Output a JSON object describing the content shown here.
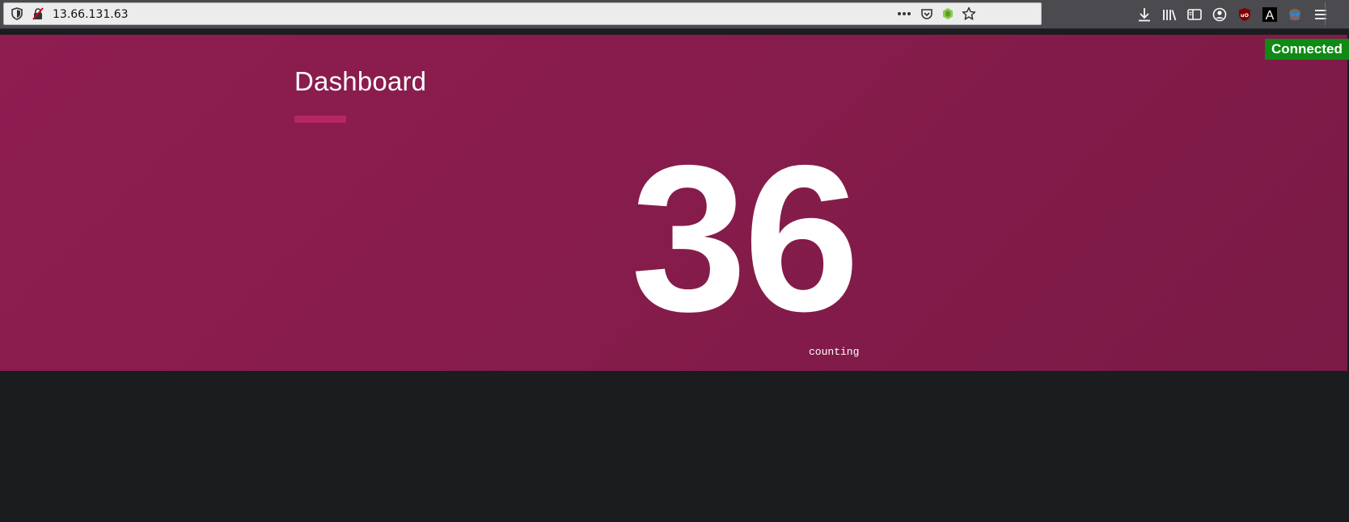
{
  "browser": {
    "url": "13.66.131.63",
    "icons": {
      "tracking_protection": "shield-icon",
      "insecure": "insecure-lock-icon",
      "page_actions": "more-dots-icon",
      "pocket": "pocket-icon",
      "extension": "node-extension-icon",
      "bookmark": "star-icon",
      "downloads": "download-icon",
      "library": "library-icon",
      "sidebar": "sidebar-icon",
      "account": "account-icon",
      "ublock": "ublock-icon",
      "font_ext": "font-a-icon",
      "mask_ext": "mask-icon",
      "menu": "hamburger-menu-icon"
    },
    "ublock_label": "uO",
    "font_ext_label": "A"
  },
  "dashboard": {
    "title": "Dashboard",
    "counter_value": "36",
    "counter_label": "counting",
    "status": "Connected",
    "colors": {
      "hero_background": "#871c4c",
      "accent_underline": "#b42664",
      "status_background": "#0f8a14",
      "page_background": "#1b1c1e"
    }
  }
}
